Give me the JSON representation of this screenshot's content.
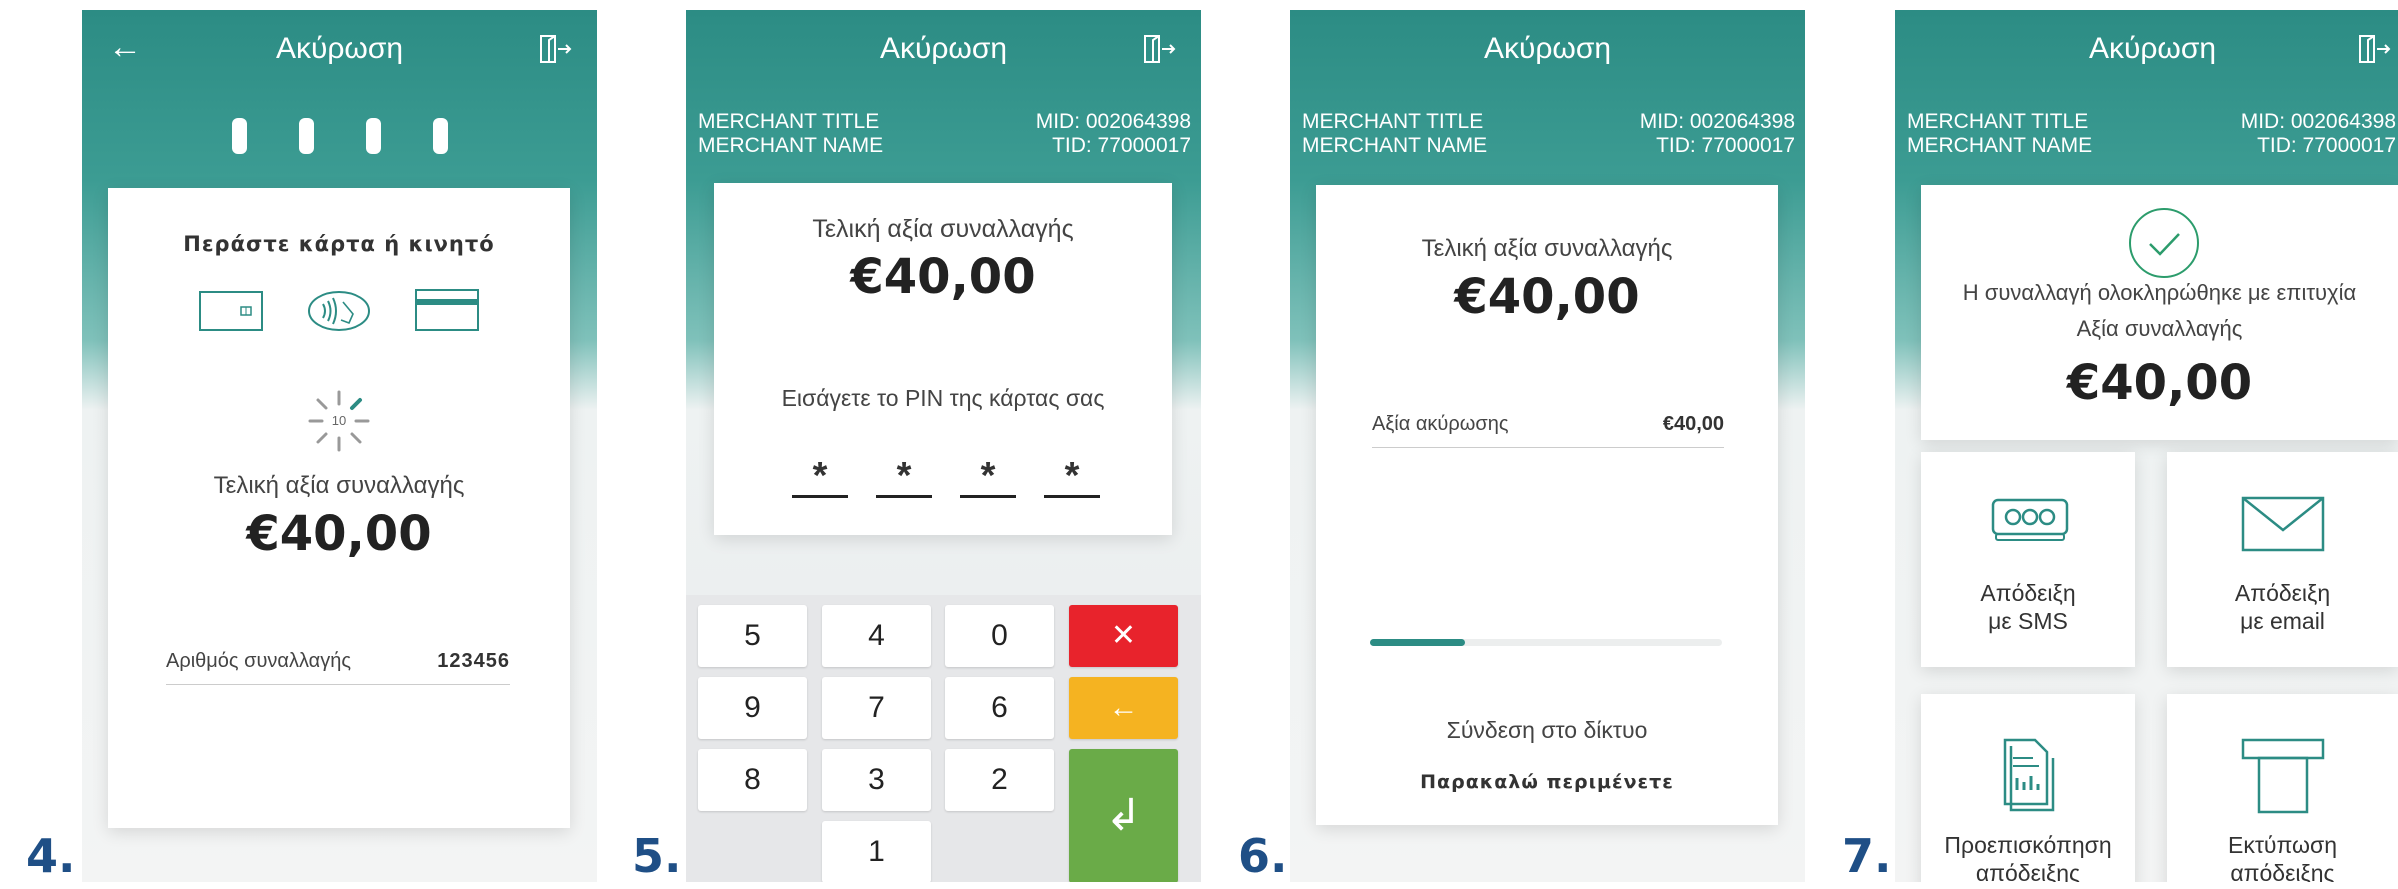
{
  "screen4": {
    "step": "4.",
    "title": "Ακύρωση",
    "prompt": "Περάστε κάρτα ή κινητό",
    "countdown": "10",
    "amount_label": "Τελική αξία συναλλαγής",
    "amount": "€40,00",
    "txn_label": "Αριθμός συναλλαγής",
    "txn_value": "123456"
  },
  "screen5": {
    "step": "5.",
    "title": "Ακύρωση",
    "merchant_title": "MERCHANT TITLE",
    "merchant_name": "MERCHANT NAME",
    "mid": "MID: 002064398",
    "tid": "TID: 77000017",
    "amount_label": "Τελική αξία συναλλαγής",
    "amount": "€40,00",
    "pin_prompt": "Εισάγετε το PIN της κάρτας σας",
    "pin_mask": [
      "*",
      "*",
      "*",
      "*"
    ],
    "keys": [
      "5",
      "4",
      "0",
      "9",
      "7",
      "6",
      "8",
      "3",
      "2",
      "1"
    ],
    "key_cancel": "✕",
    "key_back": "←",
    "key_enter": "↲"
  },
  "screen6": {
    "step": "6.",
    "title": "Ακύρωση",
    "merchant_title": "MERCHANT TITLE",
    "merchant_name": "MERCHANT NAME",
    "mid": "MID: 002064398",
    "tid": "TID: 77000017",
    "amount_label": "Τελική αξία συναλλαγής",
    "amount": "€40,00",
    "cancel_label": "Αξία ακύρωσης",
    "cancel_value": "€40,00",
    "progress": 0.27,
    "status": "Σύνδεση στο δίκτυο",
    "wait": "Παρακαλώ περιμένετε"
  },
  "screen7": {
    "step": "7.",
    "title": "Ακύρωση",
    "merchant_title": "MERCHANT TITLE",
    "merchant_name": "MERCHANT NAME",
    "mid": "MID: 002064398",
    "tid": "TID: 77000017",
    "success": "Η συναλλαγή ολοκληρώθηκε με επιτυχία",
    "amount_label": "Αξία συναλλαγής",
    "amount": "€40,00",
    "tiles": {
      "sms_l1": "Απόδειξη",
      "sms_l2": "με SMS",
      "email_l1": "Απόδειξη",
      "email_l2": "με email",
      "preview_l1": "Προεπισκόπηση",
      "preview_l2": "απόδειξης",
      "print_l1": "Εκτύπωση",
      "print_l2": "απόδειξης"
    }
  },
  "colors": {
    "teal": "#2c8c84",
    "cancel": "#e8232c",
    "back": "#f5b321",
    "enter": "#6aab48",
    "step": "#1f4f86"
  }
}
